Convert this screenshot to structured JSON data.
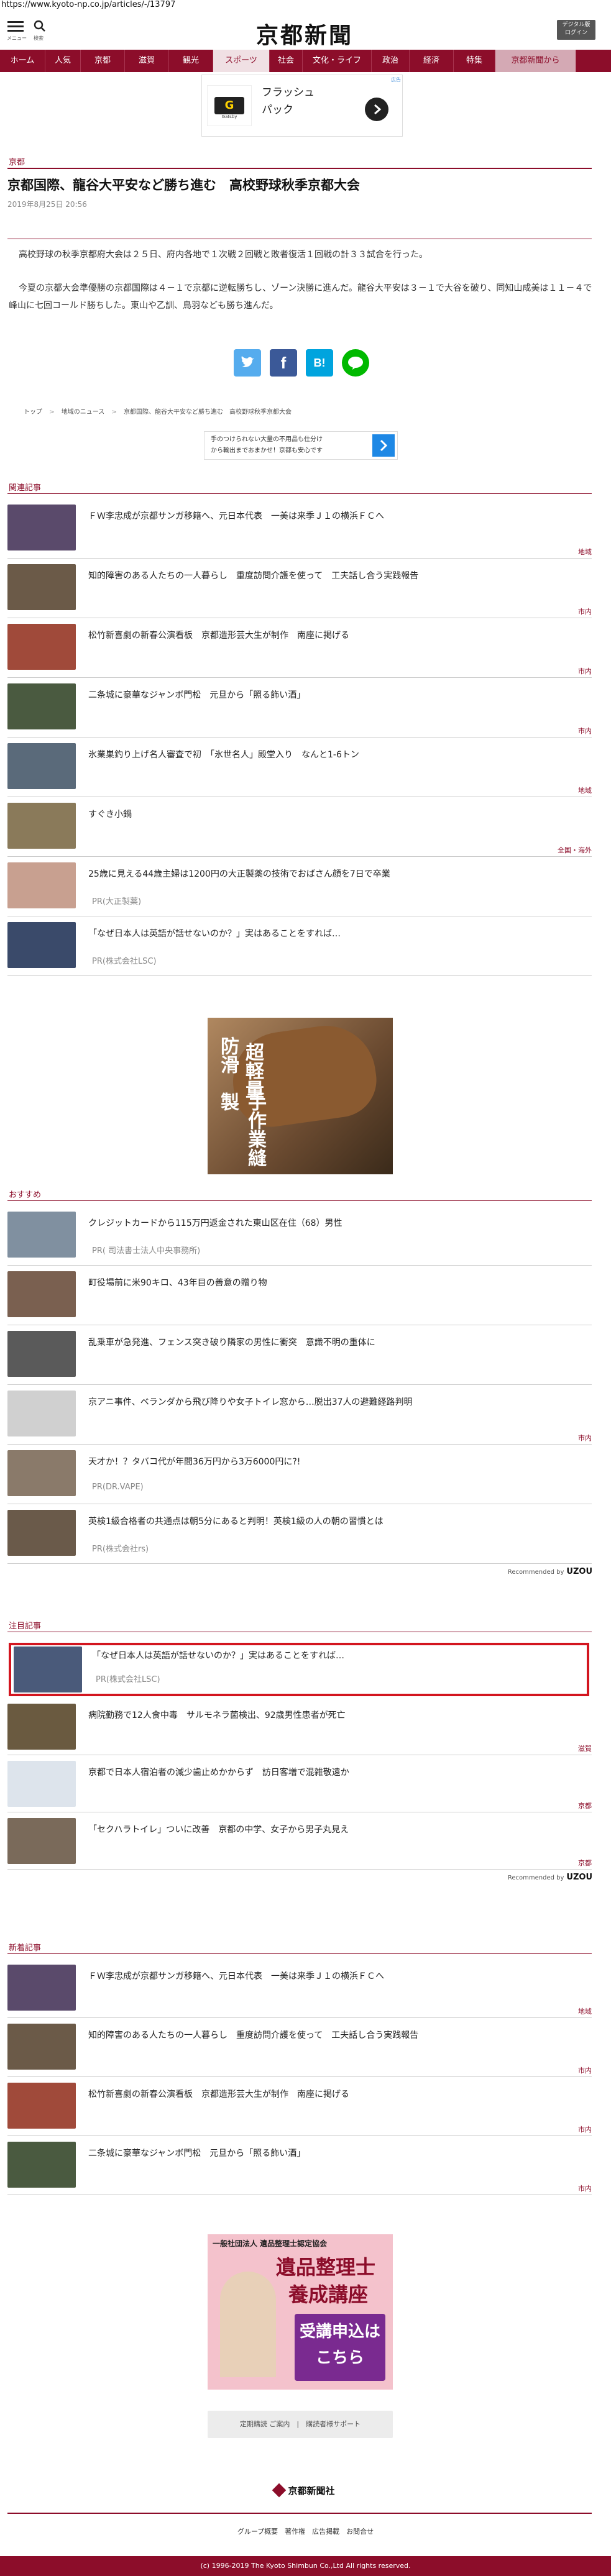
{
  "url": "https://www.kyoto-np.co.jp/articles/-/13797",
  "header": {
    "menu_label": "メニュー",
    "search_label": "検索",
    "logo": "京都新聞",
    "digital_label": "デジタル版\nログイン"
  },
  "nav": [
    "ホーム",
    "人気",
    "京都",
    "滋賀",
    "観光",
    "スポーツ",
    "社会",
    "文化・ライフ",
    "政治",
    "経済",
    "特集",
    "京都新聞から"
  ],
  "nav_active": "スポーツ",
  "ad_top": {
    "badge": "広告",
    "text": "フラッシュ\nパック",
    "brand": "Gatsby"
  },
  "article": {
    "section": "京都",
    "title": "京都国際、龍谷大平安など勝ち進む　高校野球秋季京都大会",
    "date": "2019年8月25日 20:56",
    "p1": "高校野球の秋季京都府大会は２５日、府内各地で１次戦２回戦と敗者復活１回戦の計３３試合を行った。",
    "p2": "今夏の京都大会準優勝の京都国際は４－１で京都に逆転勝ちし、ゾーン決勝に進んだ。龍谷大平安は３－１で大谷を破り、同知山成美は１１－４で峰山に七回コールド勝ちした。東山や乙訓、鳥羽なども勝ち進んだ。"
  },
  "breadcrumb": [
    "トップ",
    "地域のニュース",
    "京都国際、龍谷大平安など勝ち進む　高校野球秋季京都大会"
  ],
  "ad_mid": {
    "line1": "手のつけられない大量の不用品も仕分け",
    "line2": "から輸出までおまかせ！京都も安心です"
  },
  "related": {
    "heading": "関連記事",
    "items": [
      {
        "title": "ＦＷ李忠成が京都サンガ移籍へ、元日本代表　一美は来季Ｊ１の横浜ＦＣへ",
        "cat": "地域",
        "color": "#5a4a6b"
      },
      {
        "title": "知的障害のある人たちの一人暮らし　重度訪問介護を使って　工夫話し合う実践報告",
        "cat": "市内",
        "color": "#6b5a48"
      },
      {
        "title": "松竹新喜劇の新春公演看板　京都造形芸大生が制作　南座に掲げる",
        "cat": "市内",
        "color": "#a04a3a"
      },
      {
        "title": "二条城に豪華なジャンボ門松　元旦から「照る飾い酒」",
        "cat": "市内",
        "color": "#4a5a40"
      },
      {
        "title": "氷業巣釣り上げ名人審査で初　「氷世名人」殿堂入り　なんと1-6トン",
        "cat": "地域",
        "color": "#5a6a7a"
      },
      {
        "title": "すぐき小鍋",
        "cat": "全国・海外",
        "color": "#8a7a5a"
      },
      {
        "title": "25歳に見える44歳主婦は1200円の大正製薬の技術でおばさん顔を7日で卒業",
        "cat": "PR(大正製薬)",
        "color": "#c8a090"
      },
      {
        "title": "「なぜ日本人は英語が話せないのか？」実はあることをすれば…",
        "cat": "PR(株式会社LSC)",
        "color": "#3a4a6a"
      }
    ]
  },
  "ad_shoe": {
    "line1": "防滑",
    "line2": "超軽量",
    "line3": "手作業縫製"
  },
  "recommend": {
    "heading": "おすすめ",
    "items": [
      {
        "title": "クレジットカードから115万円返金された東山区在住（68）男性",
        "cat": "PR( 司法書士法人中央事務所)",
        "color": "#8090a0"
      },
      {
        "title": "町役場前に米90キロ、43年目の善意の贈り物",
        "cat": "",
        "color": "#7a6050"
      },
      {
        "title": "乱乗車が急発進、フェンス突き破り隣家の男性に衝突　意識不明の重体に",
        "cat": "",
        "color": "#5a5a5a"
      },
      {
        "title": "京アニ事件、ベランダから飛び降りや女子トイレ窓から…脱出37人の避難経路判明",
        "cat": "市内",
        "color": "#d0d0d0"
      },
      {
        "title": "天才か！？タバコ代が年間36万円から3万6000円に?!",
        "cat": "PR(DR.VAPE)",
        "color": "#8a7a6a"
      },
      {
        "title": "英検1級合格者の共通点は朝5分にあると判明！英検1級の人の朝の習慣とは",
        "cat": "PR(株式会社rs)",
        "color": "#6a5a4a"
      }
    ],
    "by": "Recommended by",
    "brand": "UZOU"
  },
  "notice": {
    "heading": "注目記事",
    "items": [
      {
        "title": "「なぜ日本人は英語が話せないのか？」実はあることをすれば…",
        "cat": "PR(株式会社LSC)",
        "color": "#4a5a7a"
      },
      {
        "title": "病院勤務で12人食中毒　サルモネラ菌検出、92歳男性患者が死亡",
        "cat": "滋賀",
        "color": "#6a5a40"
      },
      {
        "title": "京都で日本人宿泊者の減少歯止めかからず　訪日客増で混雑敬遠か",
        "cat": "京都",
        "color": "#dde4ec"
      },
      {
        "title": "「セクハラトイレ」ついに改善　京都の中学、女子から男子丸見え",
        "cat": "京都",
        "color": "#7a6a5a"
      }
    ],
    "by": "Recommended by",
    "brand": "UZOU"
  },
  "latest": {
    "heading": "新着記事",
    "items": [
      {
        "title": "ＦＷ李忠成が京都サンガ移籍へ、元日本代表　一美は来季Ｊ１の横浜ＦＣへ",
        "cat": "地域",
        "color": "#5a4a6b"
      },
      {
        "title": "知的障害のある人たちの一人暮らし　重度訪問介護を使って　工夫話し合う実践報告",
        "cat": "市内",
        "color": "#6b5a48"
      },
      {
        "title": "松竹新喜劇の新春公演看板　京都造形芸大生が制作　南座に掲げる",
        "cat": "市内",
        "color": "#a04a3a"
      },
      {
        "title": "二条城に豪華なジャンボ門松　元旦から「照る飾い酒」",
        "cat": "市内",
        "color": "#4a5a40"
      }
    ]
  },
  "ad_bottom": {
    "line1": "一般社団法人 遺品整理士認定協会",
    "line2": "遺品整理士",
    "line3": "養成講座",
    "line4": "受講申込は\nこちら"
  },
  "footer": {
    "button": "定期購読 ご案内　|　購読者様サポート",
    "logo": "京都新聞社",
    "links": "グループ概要　著作権　広告掲載　お問合せ",
    "copyright": "(c) 1996-2019 The Kyoto Shimbun Co.,Ltd All rights reserved."
  }
}
